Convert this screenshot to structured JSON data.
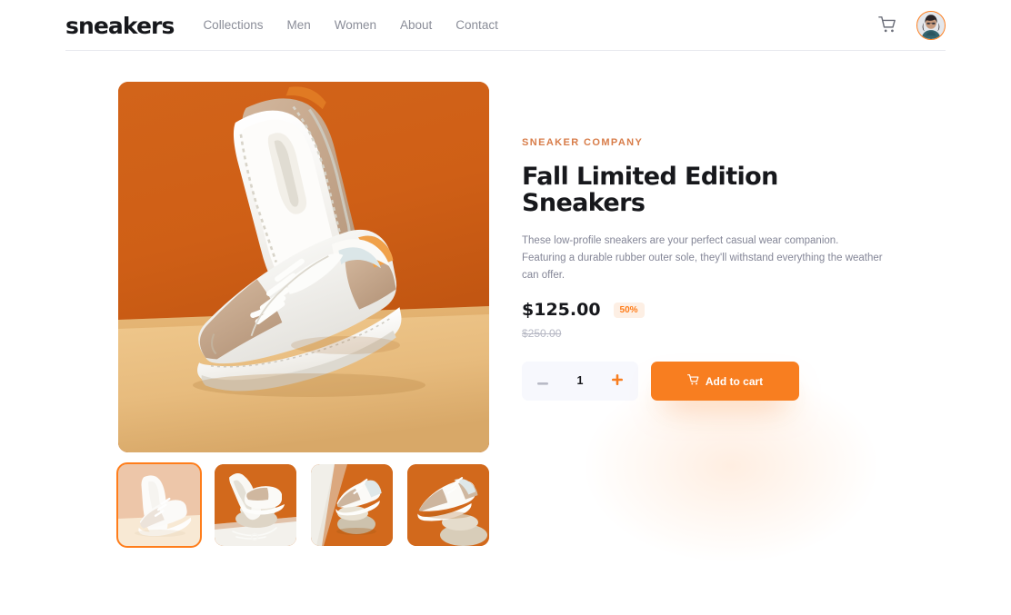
{
  "header": {
    "logo": "sneakers",
    "nav": [
      {
        "label": "Collections"
      },
      {
        "label": "Men"
      },
      {
        "label": "Women"
      },
      {
        "label": "About"
      },
      {
        "label": "Contact"
      }
    ],
    "cart_icon": "shopping-cart-icon",
    "avatar_icon": "user-avatar",
    "accent_color": "#ff7d1a"
  },
  "gallery": {
    "main_image_alt": "Fall Limited Edition Sneakers on orange and tan background",
    "thumbnails": [
      {
        "alt": "Sneakers pair upright on tan surface",
        "selected": true
      },
      {
        "alt": "Sneakers balanced on stones with laces",
        "selected": false
      },
      {
        "alt": "Single sneaker on stacked stones",
        "selected": false
      },
      {
        "alt": "Side view of sneaker above stones",
        "selected": false
      }
    ]
  },
  "product": {
    "brand": "SNEAKER COMPANY",
    "title": "Fall Limited Edition Sneakers",
    "description": "These low-profile sneakers are your perfect casual wear companion. Featuring a durable rubber outer sole, they'll withstand everything the weather can offer.",
    "price_current": "$125.00",
    "discount": "50%",
    "price_original": "$250.00"
  },
  "purchase": {
    "decrement_icon": "minus-icon",
    "quantity": "1",
    "increment_icon": "plus-icon",
    "add_to_cart_label": "Add to cart",
    "add_to_cart_icon": "cart-icon",
    "button_color": "#f87e20"
  }
}
